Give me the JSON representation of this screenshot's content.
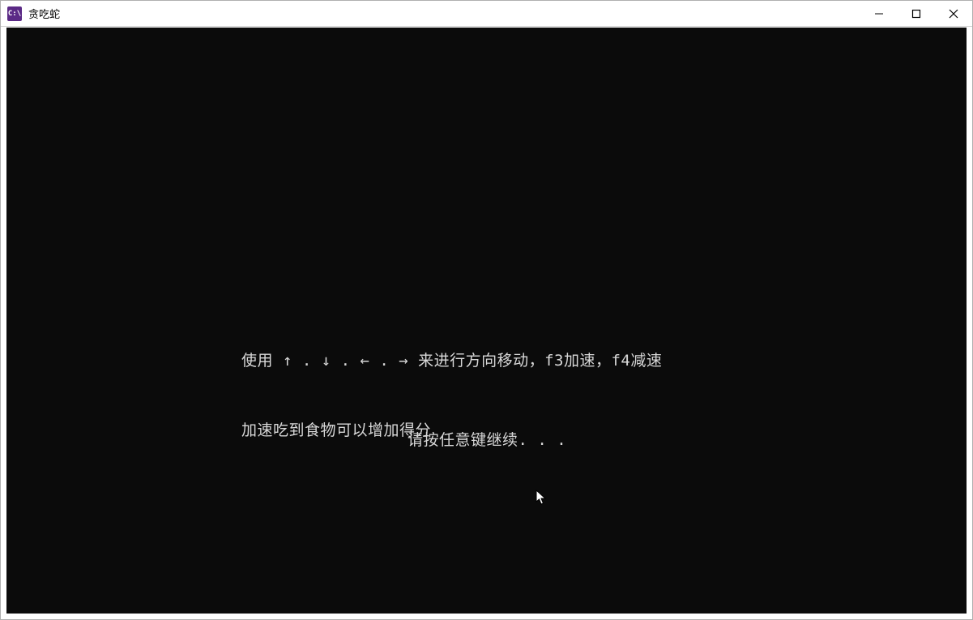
{
  "window": {
    "title": "贪吃蛇",
    "app_icon_text": "C:\\"
  },
  "console": {
    "instruction_line1": "使用 ↑ . ↓ . ← . → 来进行方向移动，f3加速，f4减速",
    "instruction_line2": "加速吃到食物可以增加得分",
    "prompt": "请按任意键继续. . ."
  }
}
